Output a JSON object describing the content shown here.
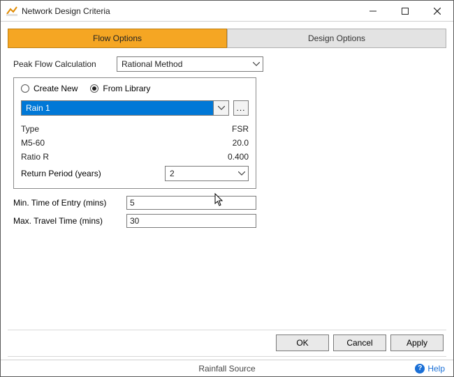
{
  "window": {
    "title": "Network Design Criteria"
  },
  "tabs": {
    "flow": "Flow Options",
    "design": "Design Options",
    "active": "flow"
  },
  "peakFlow": {
    "label": "Peak Flow Calculation",
    "method": "Rational Method"
  },
  "sourceGroup": {
    "createNew": "Create New",
    "fromLibrary": "From Library",
    "selected": "fromLibrary",
    "librarySelection": "Rain 1",
    "browseLabel": "...",
    "type": {
      "label": "Type",
      "value": "FSR"
    },
    "m560": {
      "label": "M5-60",
      "value": "20.0"
    },
    "ratioR": {
      "label": "Ratio R",
      "value": "0.400"
    },
    "returnPeriod": {
      "label": "Return Period (years)",
      "value": "2"
    }
  },
  "entryTimes": {
    "minTimeEntry": {
      "label": "Min. Time of Entry (mins)",
      "value": "5"
    },
    "maxTravelTime": {
      "label": "Max. Travel Time (mins)",
      "value": "30"
    }
  },
  "buttons": {
    "ok": "OK",
    "cancel": "Cancel",
    "apply": "Apply"
  },
  "status": {
    "center": "Rainfall Source",
    "help": "Help"
  }
}
